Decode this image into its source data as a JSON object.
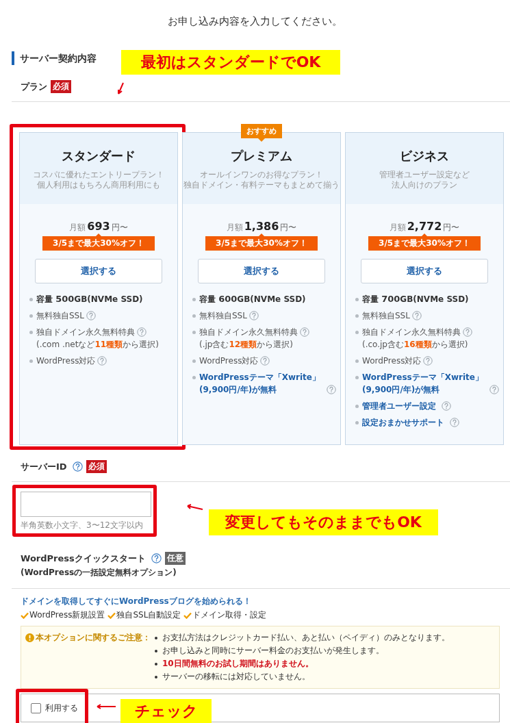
{
  "heading": "お申し込み内容を入力してください。",
  "section_title": "サーバー契約内容",
  "plan_field": {
    "label": "プラン",
    "badge": {
      "text": "必須",
      "kind": "required"
    },
    "annotation": "最初はスタンダードでOK"
  },
  "plans": [
    {
      "name": "スタンダード",
      "description": [
        "コスパに優れたエントリープラン！",
        "個人利用はもちろん商用利用にも"
      ],
      "highlighted": true,
      "price_prefix": "月額",
      "price": "693",
      "price_suffix": "円〜",
      "discount": "3/5まで最大30%オフ！",
      "button": "選択する",
      "features": [
        {
          "kind": "capacity",
          "label": "容量",
          "value": "500",
          "unit": "GB(NVMe SSD)",
          "help": false
        },
        {
          "kind": "plain",
          "text": "無料独自SSL",
          "help": true
        },
        {
          "kind": "plain",
          "text": "独自ドメイン永久無料特典",
          "help": true,
          "note": "(.com .netなど**11種類**から選択)"
        },
        {
          "kind": "plain",
          "text": "WordPress対応",
          "help": true
        }
      ]
    },
    {
      "name": "プレミアム",
      "recommended": "おすすめ",
      "description": [
        "オールインワンのお得なプラン！",
        "独自ドメイン・有料テーマもまとめて揃う"
      ],
      "highlighted": false,
      "price_prefix": "月額",
      "price": "1,386",
      "price_suffix": "円〜",
      "discount": "3/5まで最大30%オフ！",
      "button": "選択する",
      "features": [
        {
          "kind": "capacity",
          "label": "容量",
          "value": "600",
          "unit": "GB(NVMe SSD)",
          "help": false
        },
        {
          "kind": "plain",
          "text": "無料独自SSL",
          "help": true
        },
        {
          "kind": "plain",
          "text": "独自ドメイン永久無料特典",
          "help": true,
          "note": "(.jp含む**12種類**から選択)"
        },
        {
          "kind": "plain",
          "text": "WordPress対応",
          "help": true
        },
        {
          "kind": "highlight",
          "text": "WordPressテーマ「Xwrite」(9,900円/年)が無料",
          "help": true
        }
      ]
    },
    {
      "name": "ビジネス",
      "description": [
        "管理者ユーザー設定など",
        "法人向けのプラン"
      ],
      "highlighted": false,
      "price_prefix": "月額",
      "price": "2,772",
      "price_suffix": "円〜",
      "discount": "3/5まで最大30%オフ！",
      "button": "選択する",
      "features": [
        {
          "kind": "capacity",
          "label": "容量",
          "value": "700",
          "unit": "GB(NVMe SSD)",
          "help": false
        },
        {
          "kind": "plain",
          "text": "無料独自SSL",
          "help": true
        },
        {
          "kind": "plain",
          "text": "独自ドメイン永久無料特典",
          "help": true,
          "note": "(.co.jp含む**16種類**から選択)"
        },
        {
          "kind": "plain",
          "text": "WordPress対応",
          "help": true
        },
        {
          "kind": "highlight",
          "text": "WordPressテーマ「Xwrite」(9,900円/年)が無料",
          "help": true
        },
        {
          "kind": "highlight",
          "text": "管理者ユーザー設定",
          "help": true
        },
        {
          "kind": "highlight",
          "text": "設定おまかせサポート",
          "help": true
        }
      ]
    }
  ],
  "server_id": {
    "label": "サーバーID",
    "help": true,
    "badge": {
      "text": "必須",
      "kind": "required"
    },
    "hint": "半角英数小文字、3〜12文字以内",
    "highlighted": true,
    "annotation": "変更してもそのままでもOK"
  },
  "quick_start": {
    "label": "WordPressクイックスタート",
    "help": true,
    "badge": {
      "text": "任意",
      "kind": "optional"
    },
    "subtitle": "(WordPressの一括設定無料オプション)",
    "promo": "ドメインを取得してすぐにWordPressブログを始められる！",
    "benefits": [
      "WordPress新規設置",
      "独自SSL自動設定",
      "ドメイン取得・設定"
    ],
    "notice": {
      "title": "本オプションに関するご注意：",
      "items": [
        {
          "kind": "plain",
          "text": "お支払方法はクレジットカード払い、あと払い（ペイディ）のみとなります。"
        },
        {
          "kind": "plain",
          "text": "お申し込みと同時にサーバー料金のお支払いが発生します。"
        },
        {
          "kind": "warning",
          "text": "10日間無料のお試し期間はありません。"
        },
        {
          "kind": "plain",
          "text": "サーバーの移転には対応していません。"
        }
      ]
    },
    "checkbox": {
      "label": "利用する",
      "checked": false,
      "highlighted": true,
      "annotation": "チェック"
    }
  }
}
